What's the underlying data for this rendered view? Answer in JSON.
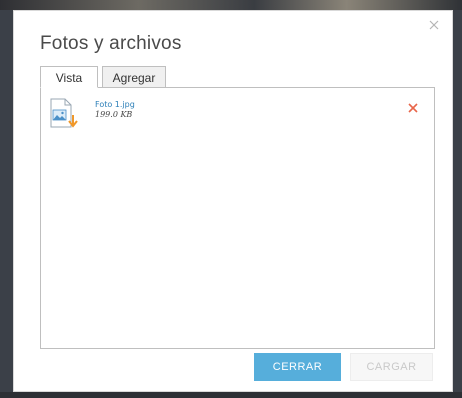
{
  "dialog": {
    "title": "Fotos y archivos",
    "close_icon": "close-icon"
  },
  "tabs": [
    {
      "label": "Vista",
      "active": true
    },
    {
      "label": "Agregar",
      "active": false
    }
  ],
  "files": [
    {
      "name": "Foto 1.jpg",
      "size": "199.0 KB",
      "icon": "image-download-icon",
      "remove_icon": "remove-icon"
    }
  ],
  "buttons": {
    "close_label": "CERRAR",
    "upload_label": "CARGAR"
  },
  "colors": {
    "primary_button": "#56aedb",
    "link": "#2c7fb8",
    "remove": "#e8664a",
    "download_arrow": "#f0982a"
  }
}
